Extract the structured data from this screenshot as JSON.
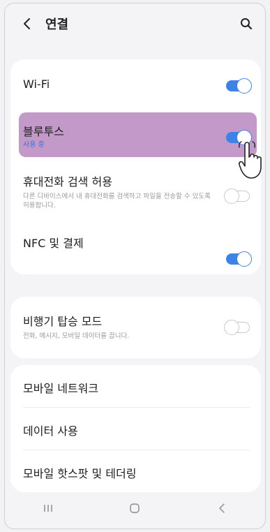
{
  "header": {
    "title": "연결",
    "back_icon": "chevron-left-icon",
    "search_icon": "search-icon"
  },
  "settings": {
    "wifi": {
      "label": "Wi-Fi",
      "enabled": true
    },
    "bluetooth": {
      "label": "블루투스",
      "status": "사용 중",
      "enabled": true
    },
    "phone_visibility": {
      "label": "휴대전화 검색 허용",
      "description": "다른 디바이스에서 내 휴대전화를 검색하고 파일을 전송할 수 있도록 허용합니다.",
      "enabled": false
    },
    "nfc": {
      "label": "NFC 및 결제",
      "enabled": true
    },
    "airplane": {
      "label": "비행기 탑승 모드",
      "description": "전화, 메시지, 모바일 데이터를 끕니다.",
      "enabled": false
    },
    "mobile_network": {
      "label": "모바일 네트워크"
    },
    "data_usage": {
      "label": "데이터 사용"
    },
    "hotspot": {
      "label": "모바일 핫스팟 및 테더링"
    }
  },
  "navbar": {
    "recents_icon": "recent-apps-icon",
    "home_icon": "home-icon",
    "back_icon": "back-icon"
  },
  "colors": {
    "accent": "#3e82e8",
    "highlight": "#c299c9",
    "background": "#f4f4f6",
    "card": "#ffffff"
  }
}
